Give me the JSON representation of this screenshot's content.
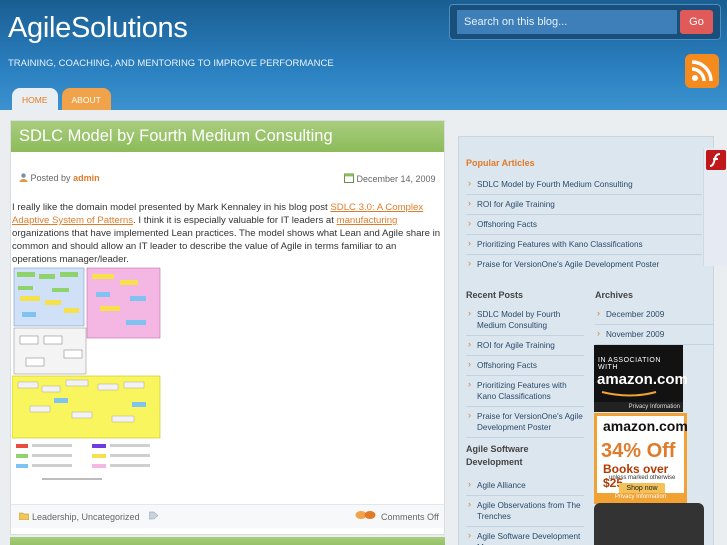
{
  "site": {
    "title": "AgileSolutions",
    "tagline": "TRAINING, COACHING, AND MENTORING TO IMPROVE PERFORMANCE"
  },
  "search": {
    "placeholder": "Search on this blog...",
    "button": "Go"
  },
  "tabs": [
    {
      "label": "HOME"
    },
    {
      "label": "ABOUT"
    }
  ],
  "post": {
    "title": "SDLC Model by Fourth Medium Consulting",
    "posted_by_label": "Posted by",
    "author": "admin",
    "date": "December 14, 2009",
    "body_pre": "I really like the domain model presented by Mark Kennaley in his blog post ",
    "link1": "SDLC 3.0: A Complex Adaptive System of Patterns",
    "body_mid": ".  I think it is especially valuable for IT leaders at ",
    "link2": "manufacturing",
    "body_post": " organizations that have implemented Lean practices.  The model shows what Lean and Agile share in common and should allow an IT leader to describe the value of Agile in terms familiar to an operations manager/leader.",
    "categories": "Leadership, Uncategorized",
    "comments": "Comments Off"
  },
  "sidebar": {
    "popular_title": "Popular Articles",
    "popular": [
      {
        "label": "SDLC Model by Fourth Medium Consulting"
      },
      {
        "label": "ROI for Agile Training"
      },
      {
        "label": "Offshoring Facts"
      },
      {
        "label": "Prioritizing Features with Kano Classifications"
      },
      {
        "label": "Praise for VersionOne's Agile Development Poster"
      }
    ],
    "recent_title": "Recent Posts",
    "recent": [
      {
        "label": "SDLC Model by Fourth Medium Consulting"
      },
      {
        "label": "ROI for Agile Training"
      },
      {
        "label": "Offshoring Facts"
      },
      {
        "label": "Prioritizing Features with Kano Classifications"
      },
      {
        "label": "Praise for VersionOne's Agile Development Poster"
      }
    ],
    "blogroll_title": "Agile Software Development",
    "blogroll": [
      {
        "label": "Agile Alliance"
      },
      {
        "label": "Agile Observations from The Trenches"
      },
      {
        "label": "Agile Software Development M..."
      }
    ],
    "archives_title": "Archives",
    "archives": [
      {
        "label": "December 2009"
      },
      {
        "label": "November 2009"
      }
    ],
    "ad1": {
      "top": "IN ASSOCIATION WITH",
      "brand": "amazon.com",
      "foot": "Privacy Information"
    },
    "ad2": {
      "brand": "amazon.com",
      "big": "34% Off",
      "line": "Books over $25",
      "small": "unless marked otherwise",
      "cta": "Shop now",
      "foot": "Privacy Information"
    }
  },
  "colors": {
    "accent": "#e07b2a",
    "header": "#2a7fbf",
    "title_bar": "#8cbb5a"
  }
}
